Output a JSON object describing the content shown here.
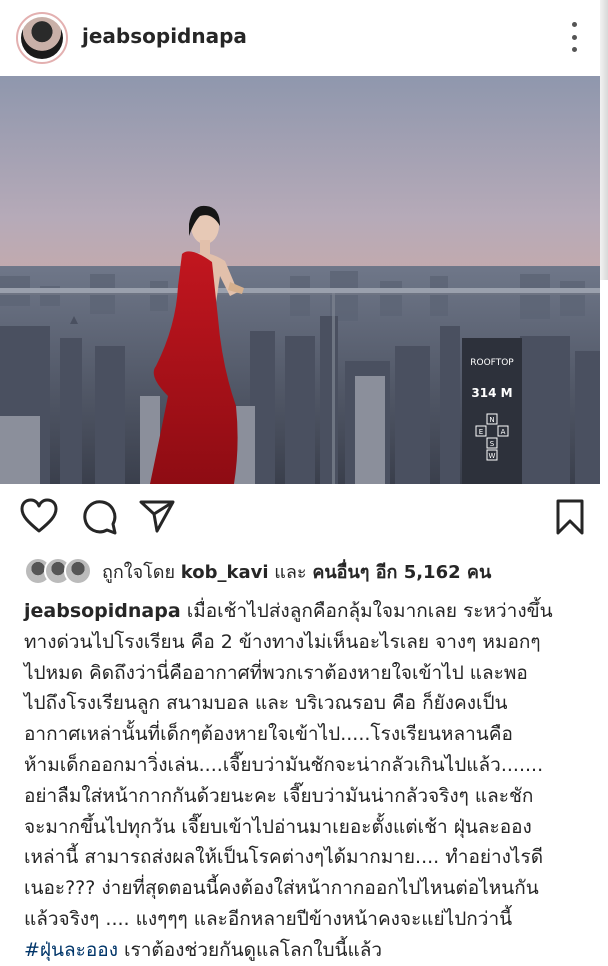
{
  "header": {
    "username": "jeabsopidnapa",
    "more_icon": "more-vertical-icon"
  },
  "post": {
    "photo_description_icon": "photo",
    "sign_text_1": "ROOFTOP",
    "sign_text_2": "314 M",
    "sign_letters": [
      "E",
      "N",
      "A",
      "S",
      "W"
    ]
  },
  "actions": {
    "like_icon": "heart-icon",
    "comment_icon": "comment-icon",
    "share_icon": "send-icon",
    "save_icon": "bookmark-icon"
  },
  "likes": {
    "prefix": "ถูกใจโดย",
    "user": "kob_kavi",
    "middle": "และ",
    "others": "คนอื่นๆ อีก 5,162 คน"
  },
  "caption": {
    "username": "jeabsopidnapa",
    "line1": " เมื่อเช้าไปส่งลูกคือกลุ้มใจมากเลย ระหว่างขึ้น",
    "line2": "ทางด่วนไปโรงเรียน คือ 2 ข้างทางไม่เห็นอะไรเลย จางๆ หมอกๆ",
    "line3": "ไปหมด คิดถึงว่านี่คืออากาศที่พวกเราต้องหายใจเข้าไป และพอ",
    "line4": "ไปถึงโรงเรียนลูก สนามบอล และ บริเวณรอบ คือ ก็ยังคงเป็น",
    "line5": "อากาศเหล่านั้นที่เด็กๆต้องหายใจเข้าไป.....โรงเรียนหลานคือ",
    "line6": "ห้ามเด็กออกมาวิ่งเล่น....เจี๊ยบว่ามันชักจะน่ากลัวเกินไปแล้ว.......",
    "line7": "อย่าลืมใส่หน้ากากกันด้วยนะคะ เจี๊ยบว่ามันน่ากลัวจริงๆ และชัก",
    "line8": "จะมากขึ้นไปทุกวัน เจี๊ยบเข้าไปอ่านมาเยอะตั้งแต่เช้า ฝุ่นละออง",
    "line9": "เหล่านี้ สามารถส่งผลให้เป็นโรคต่างๆได้มากมาย.... ทำอย่างไรดี",
    "line10": "เนอะ??? ง่ายที่สุดตอนนี้คงต้องใส่หน้ากากออกไปไหนต่อไหนกัน",
    "line11": "แล้วจริงๆ .... แงๆๆๆ และอีกหลายปีข้างหน้าคงจะแย่ไปกว่านี้",
    "hashtag": "#ฝุ่นละออง",
    "line12": " เราต้องช่วยกันดูแลโลกใบนี้แล้ว"
  },
  "colors": {
    "text": "#262626",
    "hashtag": "#003569",
    "dress": "#b3141c"
  }
}
